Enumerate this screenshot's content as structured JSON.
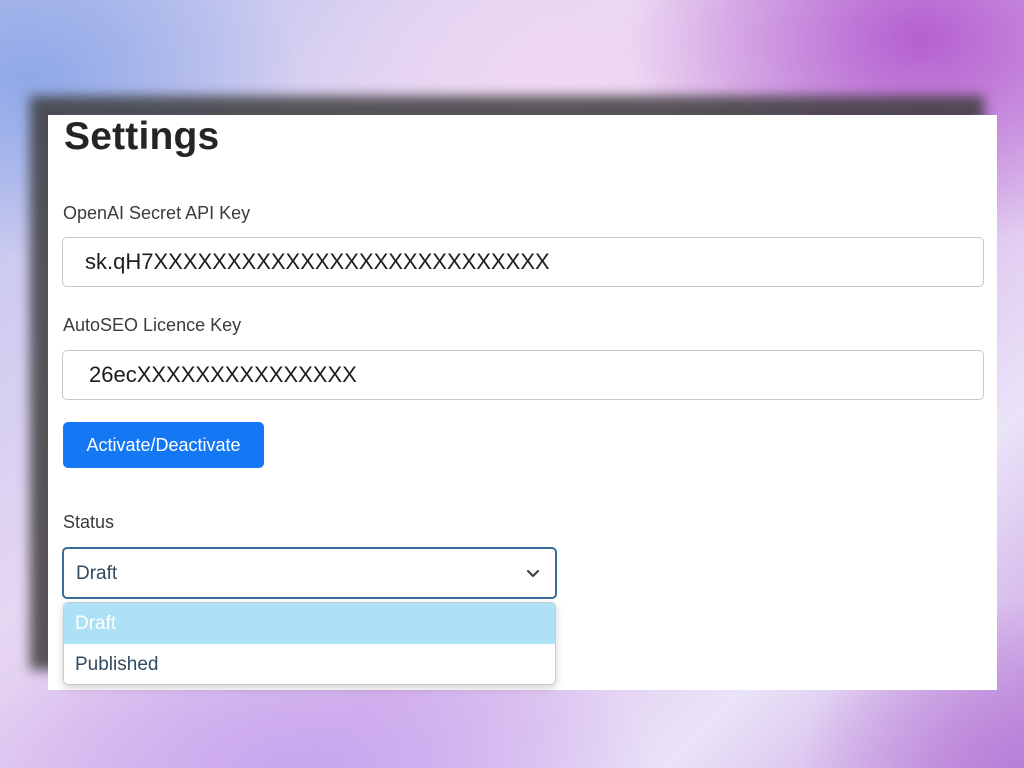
{
  "page": {
    "title": "Settings"
  },
  "openai_key": {
    "label": "OpenAI Secret API Key",
    "value": "sk.qH7XXXXXXXXXXXXXXXXXXXXXXXXXXX"
  },
  "licence_key": {
    "label": "AutoSEO Licence Key",
    "value": "26ecXXXXXXXXXXXXXXX"
  },
  "activate_button": {
    "label": "Activate/Deactivate"
  },
  "status": {
    "label": "Status",
    "selected": "Draft",
    "options": [
      "Draft",
      "Published"
    ],
    "highlighted_index": 0
  },
  "colors": {
    "primary_button": "#1478f4",
    "select_focus_border": "#3a6d9a",
    "option_highlight": "#ade1f5"
  },
  "icons": {
    "select_arrow": "chevron-down-icon"
  }
}
